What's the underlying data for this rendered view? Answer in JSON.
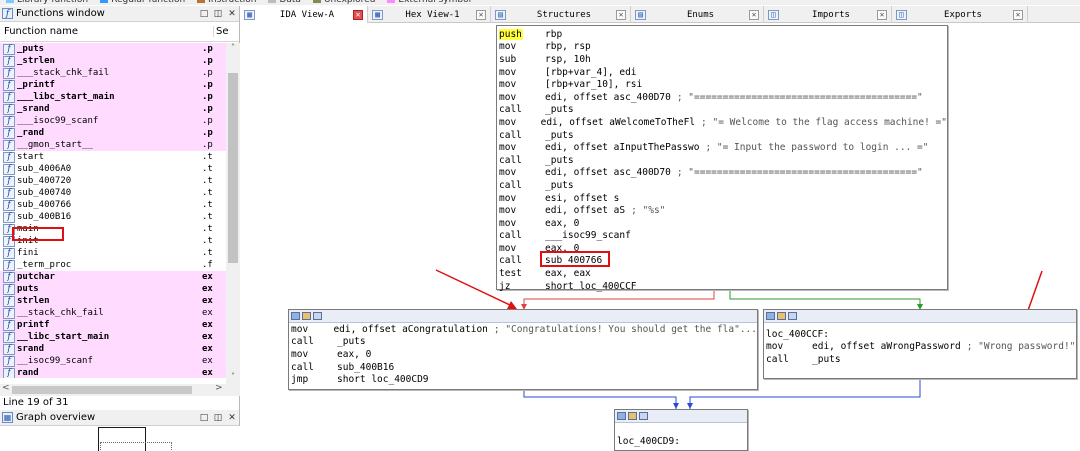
{
  "legend": [
    "Library function",
    "Regular function",
    "Instruction",
    "Data",
    "Unexplored",
    "External symbol"
  ],
  "legend_colors": [
    "#7fc8ff",
    "#3399ff",
    "#b87333",
    "#bbbbbb",
    "#8a8a50",
    "#ff88ff"
  ],
  "functions_window": {
    "title": "Functions window",
    "col_name": "Function name",
    "col_seg": "Se",
    "rows": [
      {
        "name": "_puts",
        "seg": ".p",
        "lib": true,
        "bold": true
      },
      {
        "name": "_strlen",
        "seg": ".p",
        "lib": true,
        "bold": true
      },
      {
        "name": "___stack_chk_fail",
        "seg": ".p",
        "lib": true,
        "bold": false
      },
      {
        "name": "_printf",
        "seg": ".p",
        "lib": true,
        "bold": true
      },
      {
        "name": "___libc_start_main",
        "seg": ".p",
        "lib": true,
        "bold": true
      },
      {
        "name": "_srand",
        "seg": ".p",
        "lib": true,
        "bold": true
      },
      {
        "name": "___isoc99_scanf",
        "seg": ".p",
        "lib": true,
        "bold": false
      },
      {
        "name": "_rand",
        "seg": ".p",
        "lib": true,
        "bold": true
      },
      {
        "name": "__gmon_start__",
        "seg": ".p",
        "lib": true,
        "bold": false
      },
      {
        "name": "start",
        "seg": ".t",
        "lib": false,
        "bold": false
      },
      {
        "name": "sub_4006A0",
        "seg": ".t",
        "lib": false,
        "bold": false
      },
      {
        "name": "sub_400720",
        "seg": ".t",
        "lib": false,
        "bold": false
      },
      {
        "name": "sub_400740",
        "seg": ".t",
        "lib": false,
        "bold": false
      },
      {
        "name": "sub_400766",
        "seg": ".t",
        "lib": false,
        "bold": false
      },
      {
        "name": "sub_400B16",
        "seg": ".t",
        "lib": false,
        "bold": false
      },
      {
        "name": "main",
        "seg": ".t",
        "lib": false,
        "bold": false
      },
      {
        "name": "init",
        "seg": ".t",
        "lib": false,
        "bold": false
      },
      {
        "name": "fini",
        "seg": ".t",
        "lib": false,
        "bold": false
      },
      {
        "name": "_term_proc",
        "seg": ".f",
        "lib": false,
        "bold": false
      },
      {
        "name": "putchar",
        "seg": "ex",
        "lib": true,
        "bold": true
      },
      {
        "name": "puts",
        "seg": "ex",
        "lib": true,
        "bold": true
      },
      {
        "name": "strlen",
        "seg": "ex",
        "lib": true,
        "bold": true
      },
      {
        "name": "__stack_chk_fail",
        "seg": "ex",
        "lib": true,
        "bold": false
      },
      {
        "name": "printf",
        "seg": "ex",
        "lib": true,
        "bold": true
      },
      {
        "name": "__libc_start_main",
        "seg": "ex",
        "lib": true,
        "bold": true
      },
      {
        "name": "srand",
        "seg": "ex",
        "lib": true,
        "bold": true
      },
      {
        "name": "__isoc99_scanf",
        "seg": "ex",
        "lib": true,
        "bold": false
      },
      {
        "name": "rand",
        "seg": "ex",
        "lib": true,
        "bold": true
      }
    ],
    "status": "Line 19 of 31"
  },
  "graph_overview": {
    "title": "Graph overview"
  },
  "tabs": [
    {
      "label": "IDA View-A",
      "icon": "ida-view-icon",
      "active": true
    },
    {
      "label": "Hex View-1",
      "icon": "hex-view-icon",
      "active": false
    },
    {
      "label": "Structures",
      "icon": "structures-icon",
      "active": false
    },
    {
      "label": "Enums",
      "icon": "enums-icon",
      "active": false
    },
    {
      "label": "Imports",
      "icon": "imports-icon",
      "active": false
    },
    {
      "label": "Exports",
      "icon": "exports-icon",
      "active": false
    }
  ],
  "graph": {
    "node_a": [
      {
        "mn": "push",
        "op": "rbp",
        "cm": ""
      },
      {
        "mn": "mov",
        "op": "rbp, rsp",
        "cm": ""
      },
      {
        "mn": "sub",
        "op": "rsp, 10h",
        "cm": ""
      },
      {
        "mn": "mov",
        "op": "[rbp+var_4], edi",
        "cm": ""
      },
      {
        "mn": "mov",
        "op": "[rbp+var_10], rsi",
        "cm": ""
      },
      {
        "mn": "mov",
        "op": "edi, offset asc_400D70",
        "cm": "; \"=======================================\""
      },
      {
        "mn": "call",
        "op": "_puts",
        "cm": ""
      },
      {
        "mn": "mov",
        "op": "edi, offset aWelcomeToTheFl",
        "cm": "; \"= Welcome to the flag access machine! =\""
      },
      {
        "mn": "call",
        "op": "_puts",
        "cm": ""
      },
      {
        "mn": "mov",
        "op": "edi, offset aInputThePasswo",
        "cm": "; \"=   Input the password to login ...   =\""
      },
      {
        "mn": "call",
        "op": "_puts",
        "cm": ""
      },
      {
        "mn": "mov",
        "op": "edi, offset asc_400D70",
        "cm": "; \"=======================================\""
      },
      {
        "mn": "call",
        "op": "_puts",
        "cm": ""
      },
      {
        "mn": "mov",
        "op": "esi, offset s",
        "cm": ""
      },
      {
        "mn": "mov",
        "op": "edi, offset aS",
        "cm": "; \"%s\""
      },
      {
        "mn": "mov",
        "op": "eax, 0",
        "cm": ""
      },
      {
        "mn": "call",
        "op": "___isoc99_scanf",
        "cm": ""
      },
      {
        "mn": "mov",
        "op": "eax, 0",
        "cm": ""
      },
      {
        "mn": "call",
        "op": "sub_400766",
        "cm": ""
      },
      {
        "mn": "test",
        "op": "eax, eax",
        "cm": ""
      },
      {
        "mn": "jz",
        "op": "short loc_400CCF",
        "cm": ""
      }
    ],
    "node_b": [
      {
        "mn": "mov",
        "op": "edi, offset aCongratulation",
        "cm": "; \"Congratulations! You should get the fla\"..."
      },
      {
        "mn": "call",
        "op": "_puts",
        "cm": ""
      },
      {
        "mn": "mov",
        "op": "eax, 0",
        "cm": ""
      },
      {
        "mn": "call",
        "op": "sub_400B16",
        "cm": ""
      },
      {
        "mn": "jmp",
        "op": "short loc_400CD9",
        "cm": ""
      }
    ],
    "node_c_label": "loc_400CCF:",
    "node_c": [
      {
        "mn": "mov",
        "op": "edi, offset aWrongPassword",
        "cm": "; \"Wrong password!\""
      },
      {
        "mn": "call",
        "op": "_puts",
        "cm": ""
      }
    ],
    "node_d_label": "loc_400CD9:"
  }
}
